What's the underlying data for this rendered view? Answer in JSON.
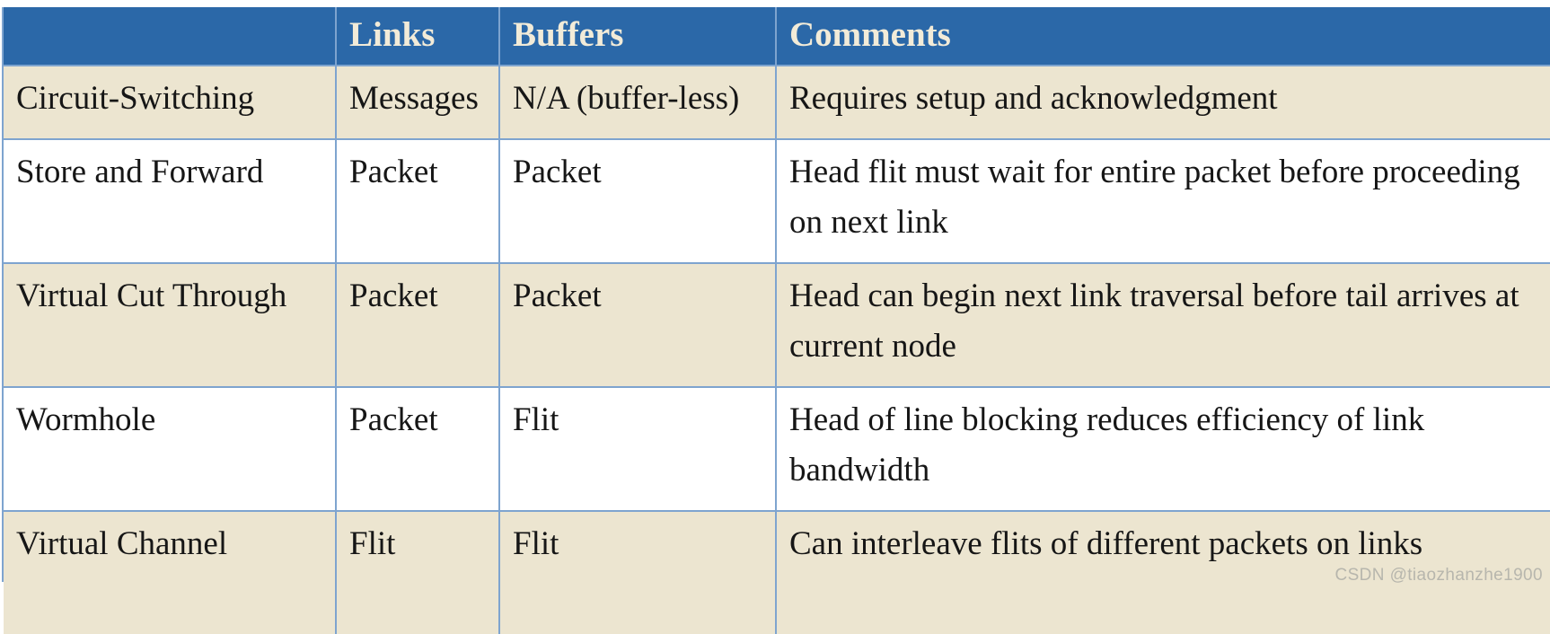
{
  "table": {
    "columns": [
      {
        "key": "technique",
        "label": ""
      },
      {
        "key": "links",
        "label": "Links"
      },
      {
        "key": "buffers",
        "label": "Buffers"
      },
      {
        "key": "comments",
        "label": "Comments"
      }
    ],
    "rows": [
      {
        "technique": "Circuit-Switching",
        "links": "Messages",
        "buffers": "N/A (buffer-less)",
        "comments": "Requires setup and acknowledgment"
      },
      {
        "technique": "Store and Forward",
        "links": "Packet",
        "buffers": "Packet",
        "comments": "Head flit must wait for entire packet before proceeding on next link"
      },
      {
        "technique": "Virtual Cut Through",
        "links": "Packet",
        "buffers": "Packet",
        "comments": "Head can begin next link traversal before tail arrives at current node"
      },
      {
        "technique": "Wormhole",
        "links": "Packet",
        "buffers": "Flit",
        "comments": "Head of line blocking reduces efficiency of link bandwidth"
      },
      {
        "technique": "Virtual Channel",
        "links": "Flit",
        "buffers": "Flit",
        "comments": "Can interleave flits of different packets on links"
      }
    ]
  },
  "watermark": {
    "text": "CSDN @tiaozhanzhe1900"
  },
  "colors": {
    "header_background": "#2b68a8",
    "header_text": "#f2ebd8",
    "shaded_row": "#ece5d0",
    "plain_row": "#ffffff",
    "grid_line": "#7ea4cf",
    "body_text": "#161616",
    "watermark_text": "#b7b6ad"
  }
}
